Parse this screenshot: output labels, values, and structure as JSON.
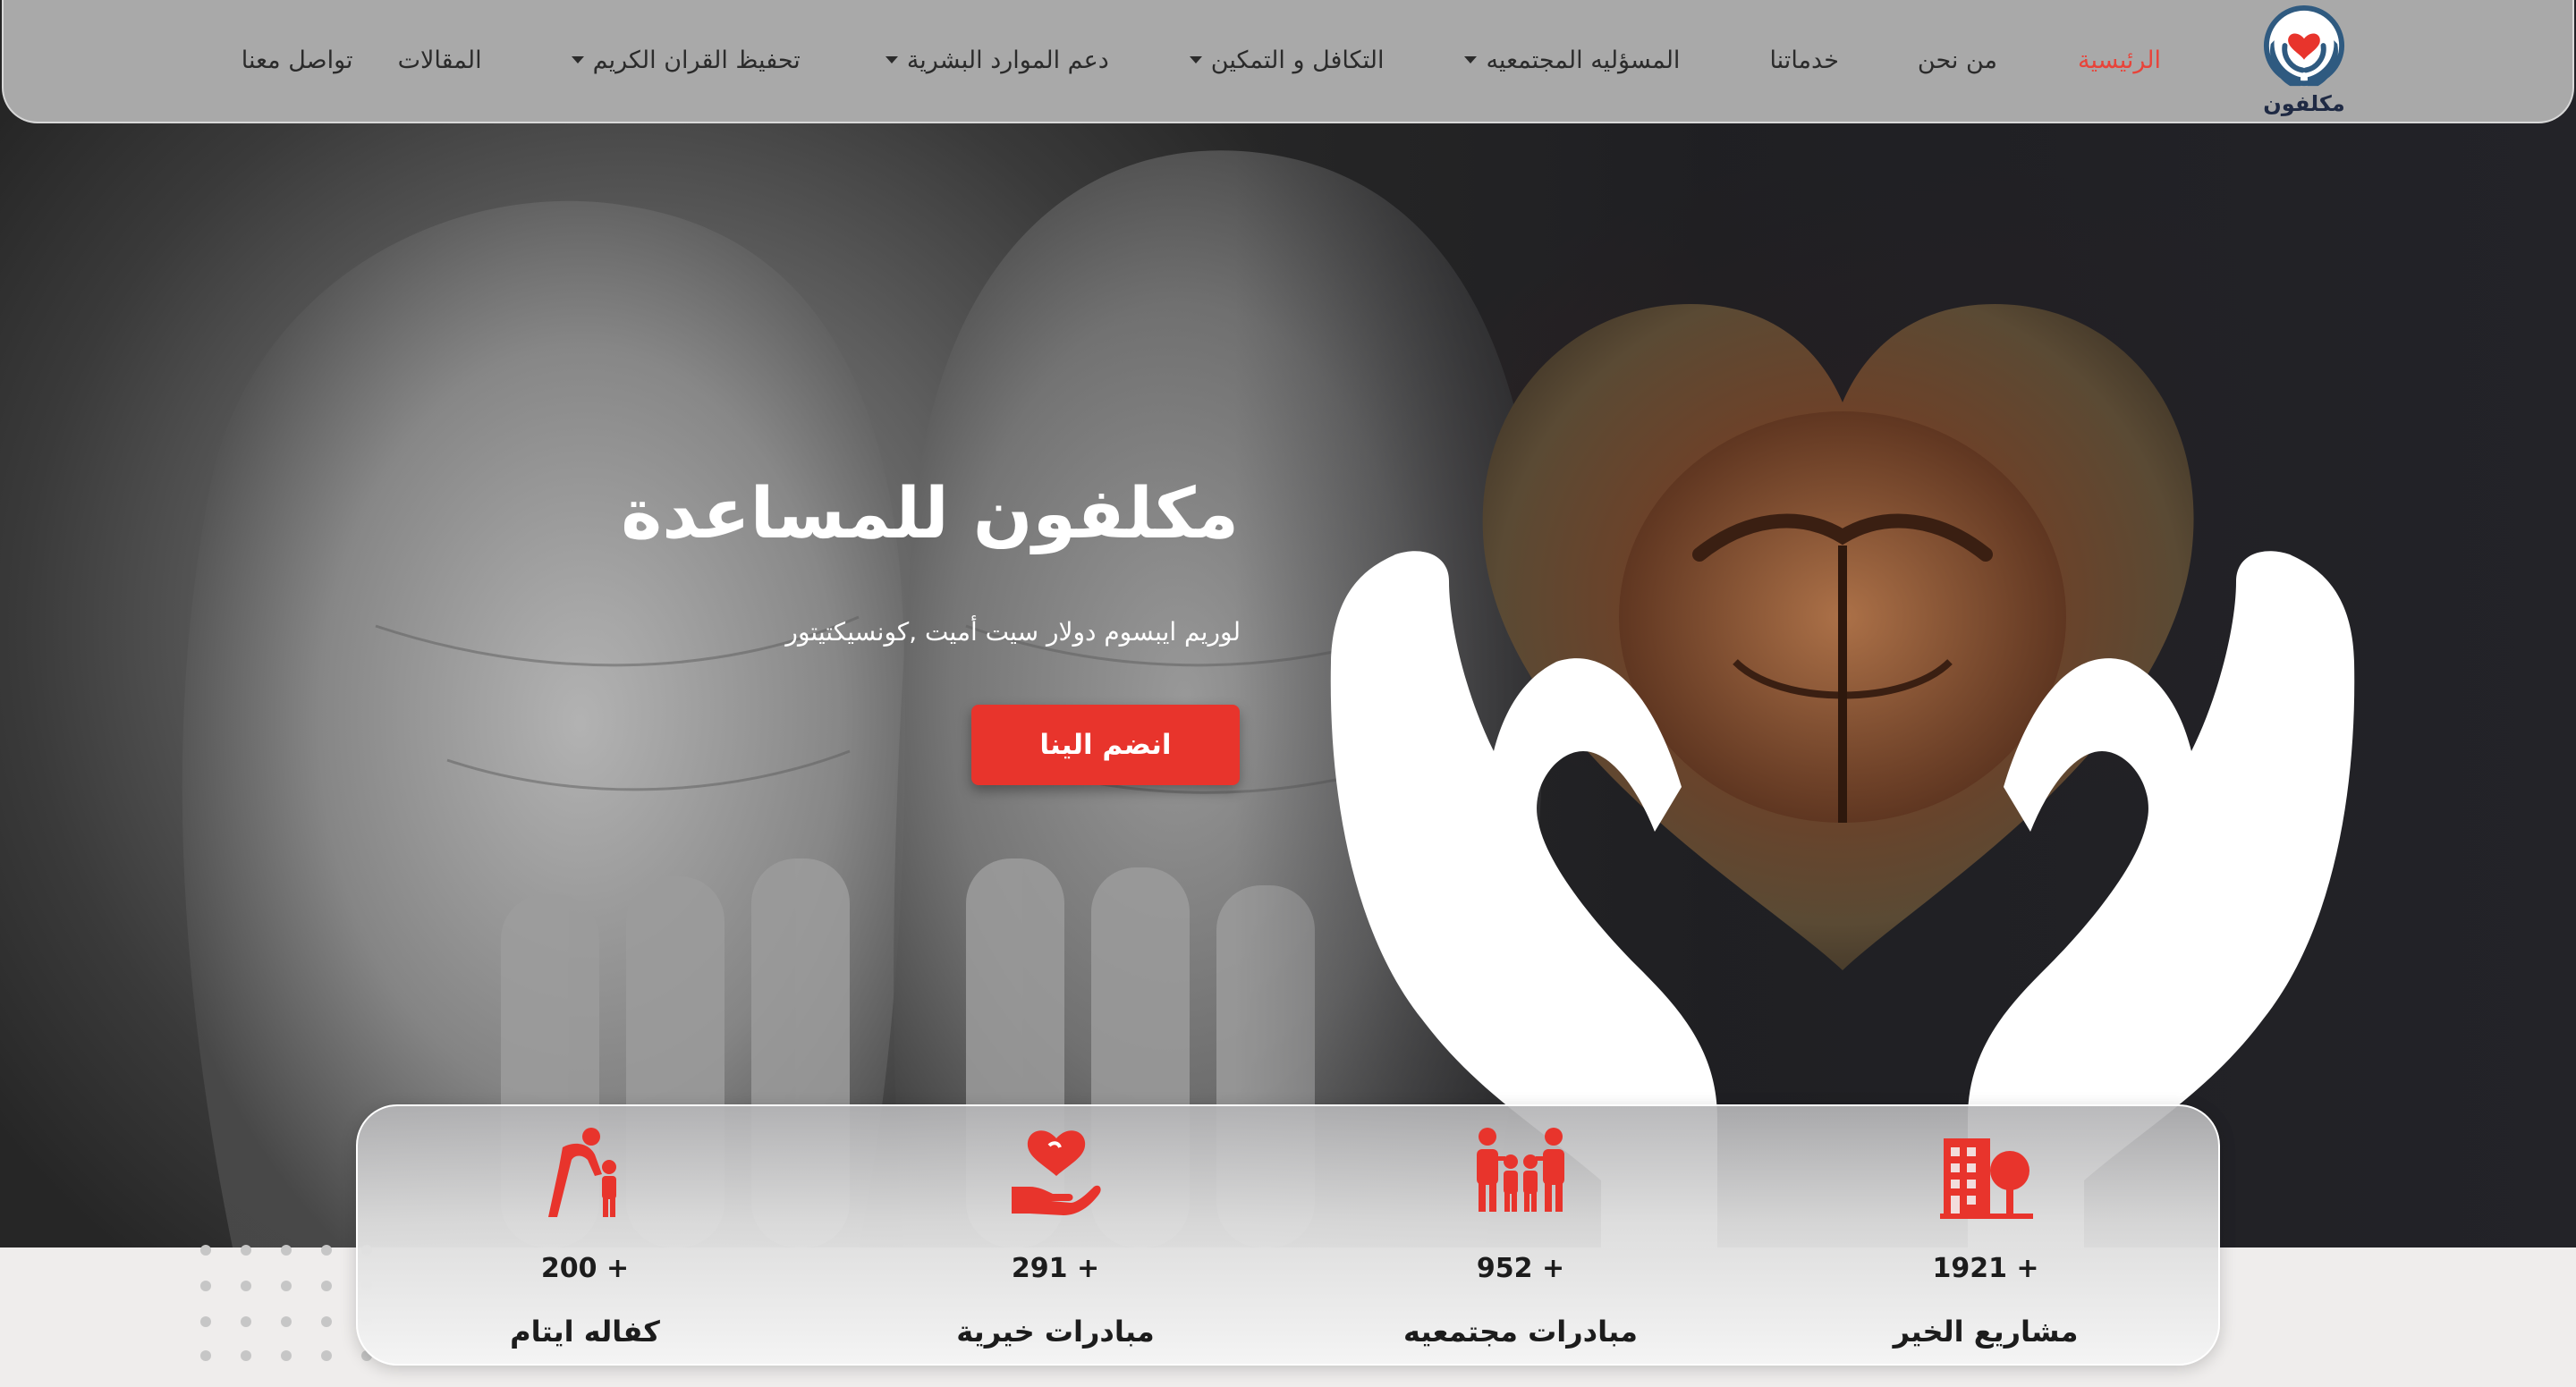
{
  "brand": {
    "name": "مكلفون",
    "accent": "#e8342c",
    "navy": "#1f3b5c"
  },
  "nav": {
    "items": [
      {
        "label": "الرئيسية",
        "active": true,
        "dropdown": false
      },
      {
        "label": "من نحن",
        "active": false,
        "dropdown": false
      },
      {
        "label": "خدماتنا",
        "active": false,
        "dropdown": false
      },
      {
        "label": "المسؤليه المجتمعيه",
        "active": false,
        "dropdown": true
      },
      {
        "label": "التكافل و التمكين",
        "active": false,
        "dropdown": true
      },
      {
        "label": "دعم الموارد البشرية",
        "active": false,
        "dropdown": true
      },
      {
        "label": "تحفيظ القران الكريم",
        "active": false,
        "dropdown": true
      },
      {
        "label": "المقالات",
        "active": false,
        "dropdown": false
      },
      {
        "label": "تواصل معنا",
        "active": false,
        "dropdown": false
      }
    ]
  },
  "hero": {
    "title": "مكلفون للمساعدة",
    "subtitle": "لوريم ايبسوم دولار سيت أميت ,كونسيكتيتور",
    "cta_label": "انضم الينا"
  },
  "stats": [
    {
      "number": "1921 +",
      "label": "مشاريع الخير",
      "icon": "building-tree-icon"
    },
    {
      "number": "952 +",
      "label": "مبادرات مجتمعيه",
      "icon": "family-icon"
    },
    {
      "number": "291 +",
      "label": "مبادرات خيرية",
      "icon": "heart-hand-icon"
    },
    {
      "number": "200 +",
      "label": "كفاله ايتام",
      "icon": "parent-child-icon"
    }
  ]
}
